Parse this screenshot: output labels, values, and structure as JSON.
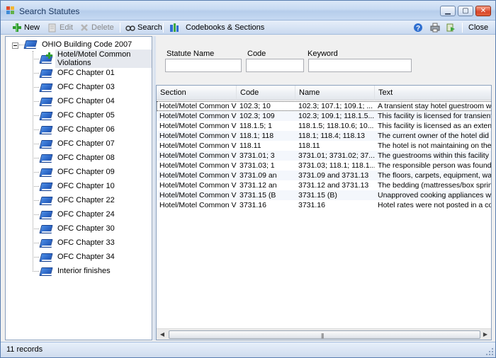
{
  "window": {
    "title": "Search Statutes"
  },
  "toolbar": {
    "new_label": "New",
    "edit_label": "Edit",
    "delete_label": "Delete",
    "search_label": "Search",
    "codebooks_label": "Codebooks & Sections",
    "close_label": "Close"
  },
  "tree": {
    "root_label": "OHIO Building Code 2007",
    "items": [
      {
        "label": "Hotel/Motel Common Violations"
      },
      {
        "label": "OFC Chapter 01"
      },
      {
        "label": "OFC Chapter 03"
      },
      {
        "label": "OFC Chapter 04"
      },
      {
        "label": "OFC Chapter 05"
      },
      {
        "label": "OFC Chapter 06"
      },
      {
        "label": "OFC Chapter 07"
      },
      {
        "label": "OFC Chapter 08"
      },
      {
        "label": "OFC Chapter 09"
      },
      {
        "label": "OFC Chapter 10"
      },
      {
        "label": "OFC Chapter 22"
      },
      {
        "label": "OFC Chapter 24"
      },
      {
        "label": "OFC Chapter 30"
      },
      {
        "label": "OFC Chapter 33"
      },
      {
        "label": "OFC Chapter 34"
      },
      {
        "label": "Interior finishes"
      }
    ]
  },
  "search": {
    "statute_name_label": "Statute Name",
    "code_label": "Code",
    "keyword_label": "Keyword",
    "statute_name_value": "",
    "code_value": "",
    "keyword_value": ""
  },
  "grid": {
    "columns": [
      "Section",
      "Code",
      "Name",
      "Text"
    ],
    "rows": [
      [
        "Hotel/Motel Common Vi...",
        "102.3;  10",
        "102.3;  107.1;  109.1;  ...",
        "A transient stay hotel guestroom was fo"
      ],
      [
        "Hotel/Motel Common Vi...",
        "102.3; 109",
        "102.3; 109.1; 118.1.5....",
        "This facility is licensed for transient use o"
      ],
      [
        "Hotel/Motel Common Vi...",
        "118.1.5; 1",
        "118.1.5; 118.10.6; 10...",
        "This facility is licensed as an extended st"
      ],
      [
        "Hotel/Motel Common Vi...",
        "118.1; 118",
        "118.1; 118.4; 118.13",
        "The current owner of the hotel did not a"
      ],
      [
        "Hotel/Motel Common Vi...",
        "118.11",
        "118.11",
        "The hotel is not maintaining on the prem"
      ],
      [
        "Hotel/Motel Common Vi...",
        "3731.01; 3",
        "3731.01; 3731.02; 37...",
        "The guestrooms within this facility are no"
      ],
      [
        "Hotel/Motel Common Vi...",
        "3731.03; 1",
        "3731.03; 118.1; 118.1...",
        "The responsible person was found to be"
      ],
      [
        "Hotel/Motel Common Vi...",
        "3731.09 an",
        "3731.09 and 3731.13",
        "The floors, carpets, equipment, walls an"
      ],
      [
        "Hotel/Motel Common Vi...",
        "3731.12 an",
        "3731.12 and 3731.13",
        "The bedding (mattresses/box springs) ar"
      ],
      [
        "Hotel/Motel Common Vi...",
        "3731.15 (B",
        "3731.15 (B)",
        "Unapproved cooking appliances were fou"
      ],
      [
        "Hotel/Motel Common Vi...",
        "3731.16",
        "3731.16",
        "Hotel rates were not posted in a conspic"
      ]
    ]
  },
  "status": {
    "text": "11 records"
  },
  "colors": {
    "title_text": "#1e3a63",
    "book_blue": "#1b4fb1",
    "add_green": "#2f9b2f"
  }
}
